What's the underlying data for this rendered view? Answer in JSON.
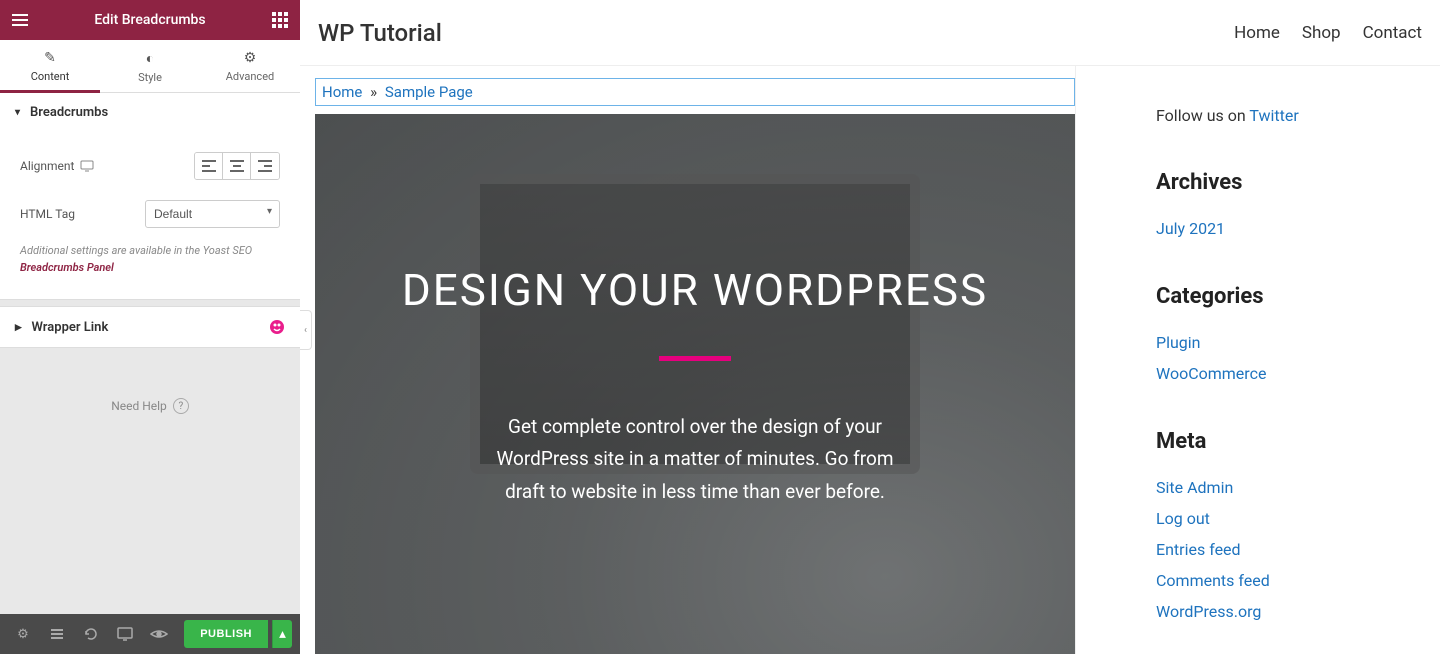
{
  "sidebar": {
    "title": "Edit Breadcrumbs",
    "tabs": {
      "content": "Content",
      "style": "Style",
      "advanced": "Advanced"
    },
    "section_breadcrumbs": "Breadcrumbs",
    "alignment_label": "Alignment",
    "html_tag_label": "HTML Tag",
    "html_tag_value": "Default",
    "note_text": "Additional settings are available in the Yoast SEO ",
    "note_link": "Breadcrumbs Panel",
    "wrapper_link": "Wrapper Link",
    "need_help": "Need Help",
    "publish": "PUBLISH"
  },
  "site": {
    "title": "WP Tutorial",
    "nav": {
      "home": "Home",
      "shop": "Shop",
      "contact": "Contact"
    },
    "breadcrumb": {
      "home": "Home",
      "sep": "»",
      "current": "Sample Page"
    },
    "hero": {
      "title": "DESIGN YOUR WORDPRESS",
      "text": "Get complete control over the design of your WordPress site in a matter of minutes. Go from draft to website in less time than ever before."
    }
  },
  "widgets": {
    "follow_pre": "Follow us on ",
    "follow_link": "Twitter",
    "archives_title": "Archives",
    "archives": [
      "July 2021"
    ],
    "categories_title": "Categories",
    "categories": [
      "Plugin",
      "WooCommerce"
    ],
    "meta_title": "Meta",
    "meta": [
      "Site Admin",
      "Log out",
      "Entries feed",
      "Comments feed",
      "WordPress.org"
    ]
  }
}
